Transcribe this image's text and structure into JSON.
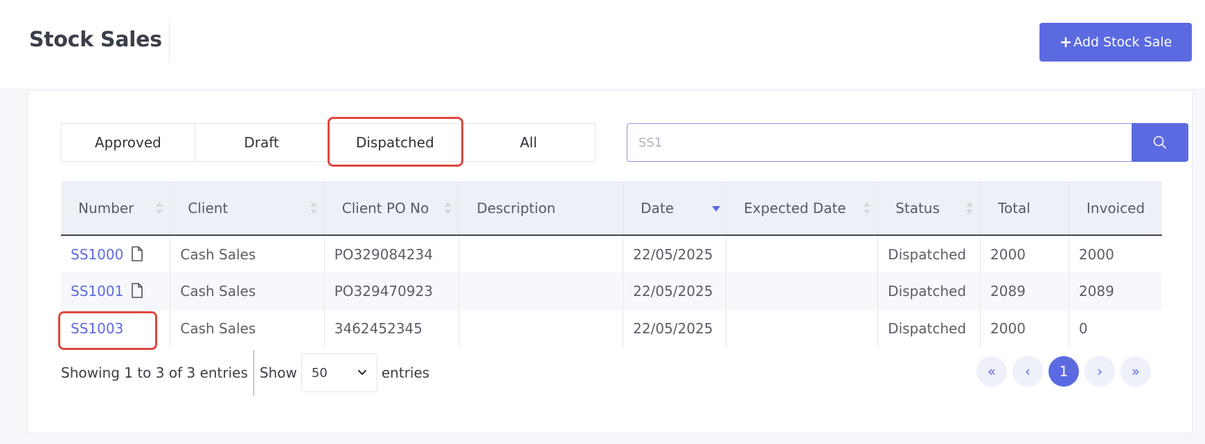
{
  "page": {
    "title": "Stock Sales",
    "add_button_plus": "+",
    "add_button_label": "Add Stock Sale"
  },
  "tabs": [
    {
      "label": "Approved"
    },
    {
      "label": "Draft"
    },
    {
      "label": "Dispatched",
      "active": true
    },
    {
      "label": "All"
    }
  ],
  "search": {
    "value": "SS1",
    "button_icon": "search-icon"
  },
  "table": {
    "columns": [
      "Number",
      "Client",
      "Client PO No",
      "Description",
      "Date",
      "Expected Date",
      "Status",
      "Total",
      "Invoiced"
    ],
    "rows": [
      {
        "number": "SS1000",
        "client": "Cash Sales",
        "po": "PO329084234",
        "description": "",
        "date": "22/05/2025",
        "expected": "",
        "status": "Dispatched",
        "total": "2000",
        "invoiced": "2000"
      },
      {
        "number": "SS1001",
        "client": "Cash Sales",
        "po": "PO329470923",
        "description": "",
        "date": "22/05/2025",
        "expected": "",
        "status": "Dispatched",
        "total": "2089",
        "invoiced": "2089"
      },
      {
        "number": "SS1003",
        "client": "Cash Sales",
        "po": "3462452345",
        "description": "",
        "date": "22/05/2025",
        "expected": "",
        "status": "Dispatched",
        "total": "2000",
        "invoiced": "0"
      }
    ]
  },
  "footer": {
    "info": "Showing 1 to 3 of 3 entries",
    "show_label": "Show",
    "page_length": "50",
    "entries_label": "entries"
  },
  "pagination": {
    "first": "«",
    "prev": "‹",
    "current": "1",
    "next": "›",
    "last": "»"
  },
  "colors": {
    "accent": "#5b6ae0",
    "highlight": "#e0463e"
  }
}
